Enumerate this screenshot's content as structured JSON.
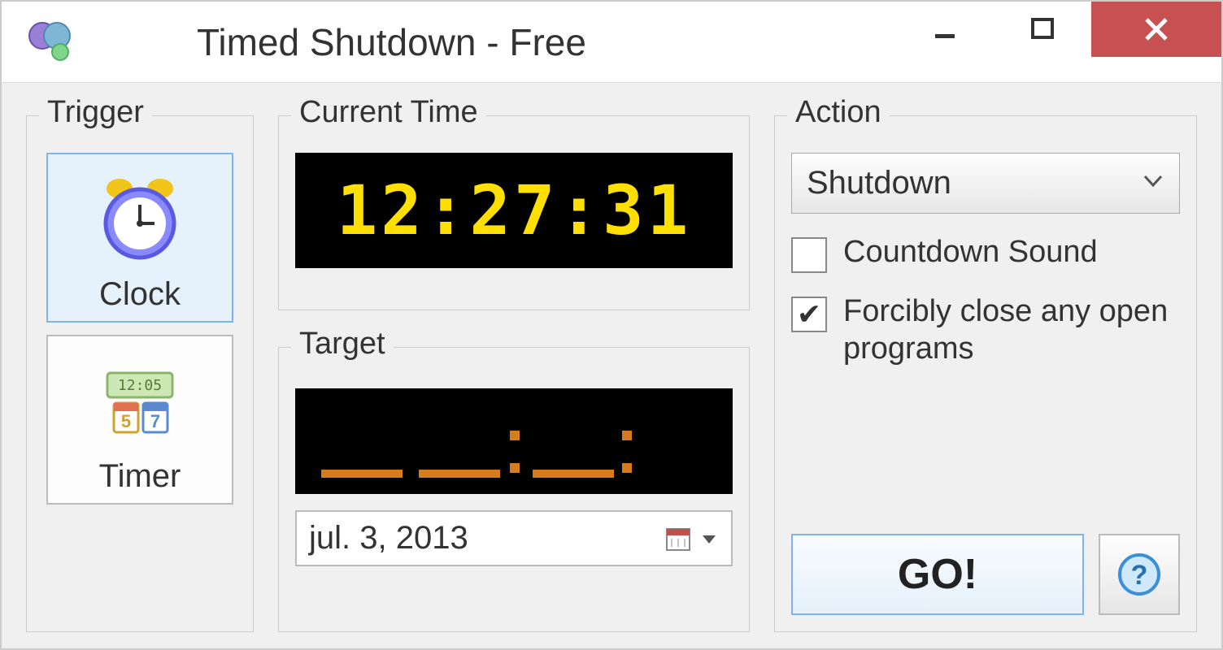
{
  "window": {
    "title": "Timed Shutdown - Free"
  },
  "trigger": {
    "legend": "Trigger",
    "clock_label": "Clock",
    "timer_label": "Timer",
    "selected": "clock"
  },
  "current_time": {
    "legend": "Current Time",
    "value": "12:27:31"
  },
  "target": {
    "legend": "Target",
    "time_value": "__:__:__",
    "date_value": "jul.    3, 2013"
  },
  "action": {
    "legend": "Action",
    "dropdown_value": "Shutdown",
    "countdown_sound_label": "Countdown Sound",
    "countdown_sound_checked": false,
    "force_close_label": "Forcibly close any open programs",
    "force_close_checked": true,
    "go_label": "GO!"
  },
  "colors": {
    "lcd_bg": "#000000",
    "lcd_fg": "#ffdf00",
    "lcd_dim": "#d67c1c",
    "close_btn": "#c75050",
    "selected_border": "#7eb4ea"
  }
}
